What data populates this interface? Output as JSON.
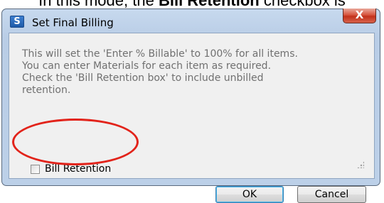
{
  "caption": {
    "prefix": "In this mode, the",
    "bold": "Bill Retention",
    "suffix": "checkbox is"
  },
  "window": {
    "title": "Set Final Billing",
    "app_icon_letter": "S",
    "close_label": "X"
  },
  "message": {
    "lines": [
      "This will set the 'Enter % Billable' to 100% for all items.",
      "You can enter Materials for each item as required.",
      "Check the 'Bill Retention box' to include unbilled",
      "retention."
    ]
  },
  "bill_retention": {
    "label": "Bill Retention",
    "checked": false
  },
  "buttons": {
    "ok": "OK",
    "cancel": "Cancel"
  },
  "colors": {
    "highlight": "#e2231a",
    "message_text": "#707070",
    "client_bg": "#f0f0f0"
  }
}
